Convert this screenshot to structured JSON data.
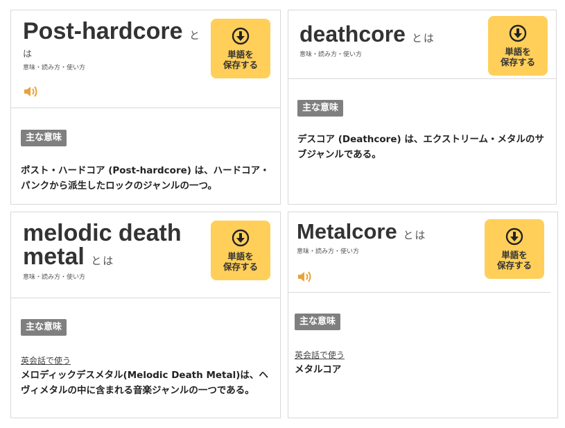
{
  "common": {
    "subtitle": "意味・読み方・使い方",
    "save_label_1": "単語を",
    "save_label_2": "保存する",
    "main_meaning_badge": "主な意味",
    "eikaiwa_link": "英会話で使う",
    "toha": "とは"
  },
  "cards": [
    {
      "word": "Post-hardcore",
      "toha_1": "と",
      "toha_2": "は",
      "meaning": "ポスト・ハードコア (Post-hardcore) は、ハードコア・パンクから派生したロックのジャンルの一つ。"
    },
    {
      "word": "deathcore",
      "meaning": "デスコア (Deathcore) は、エクストリーム・メタルのサブジャンルである。"
    },
    {
      "word_line1": "melodic death",
      "word_line2": "metal",
      "meaning": "メロディックデスメタル(Melodic Death Metal)は、ヘヴィメタルの中に含まれる音楽ジャンルの一つである。"
    },
    {
      "word": "Metalcore",
      "meaning": "メタルコア"
    }
  ],
  "colors": {
    "save_button": "#ffcf5a",
    "speaker": "#e8a33a",
    "badge": "#7f7f7f",
    "border": "#d9d9d9"
  }
}
